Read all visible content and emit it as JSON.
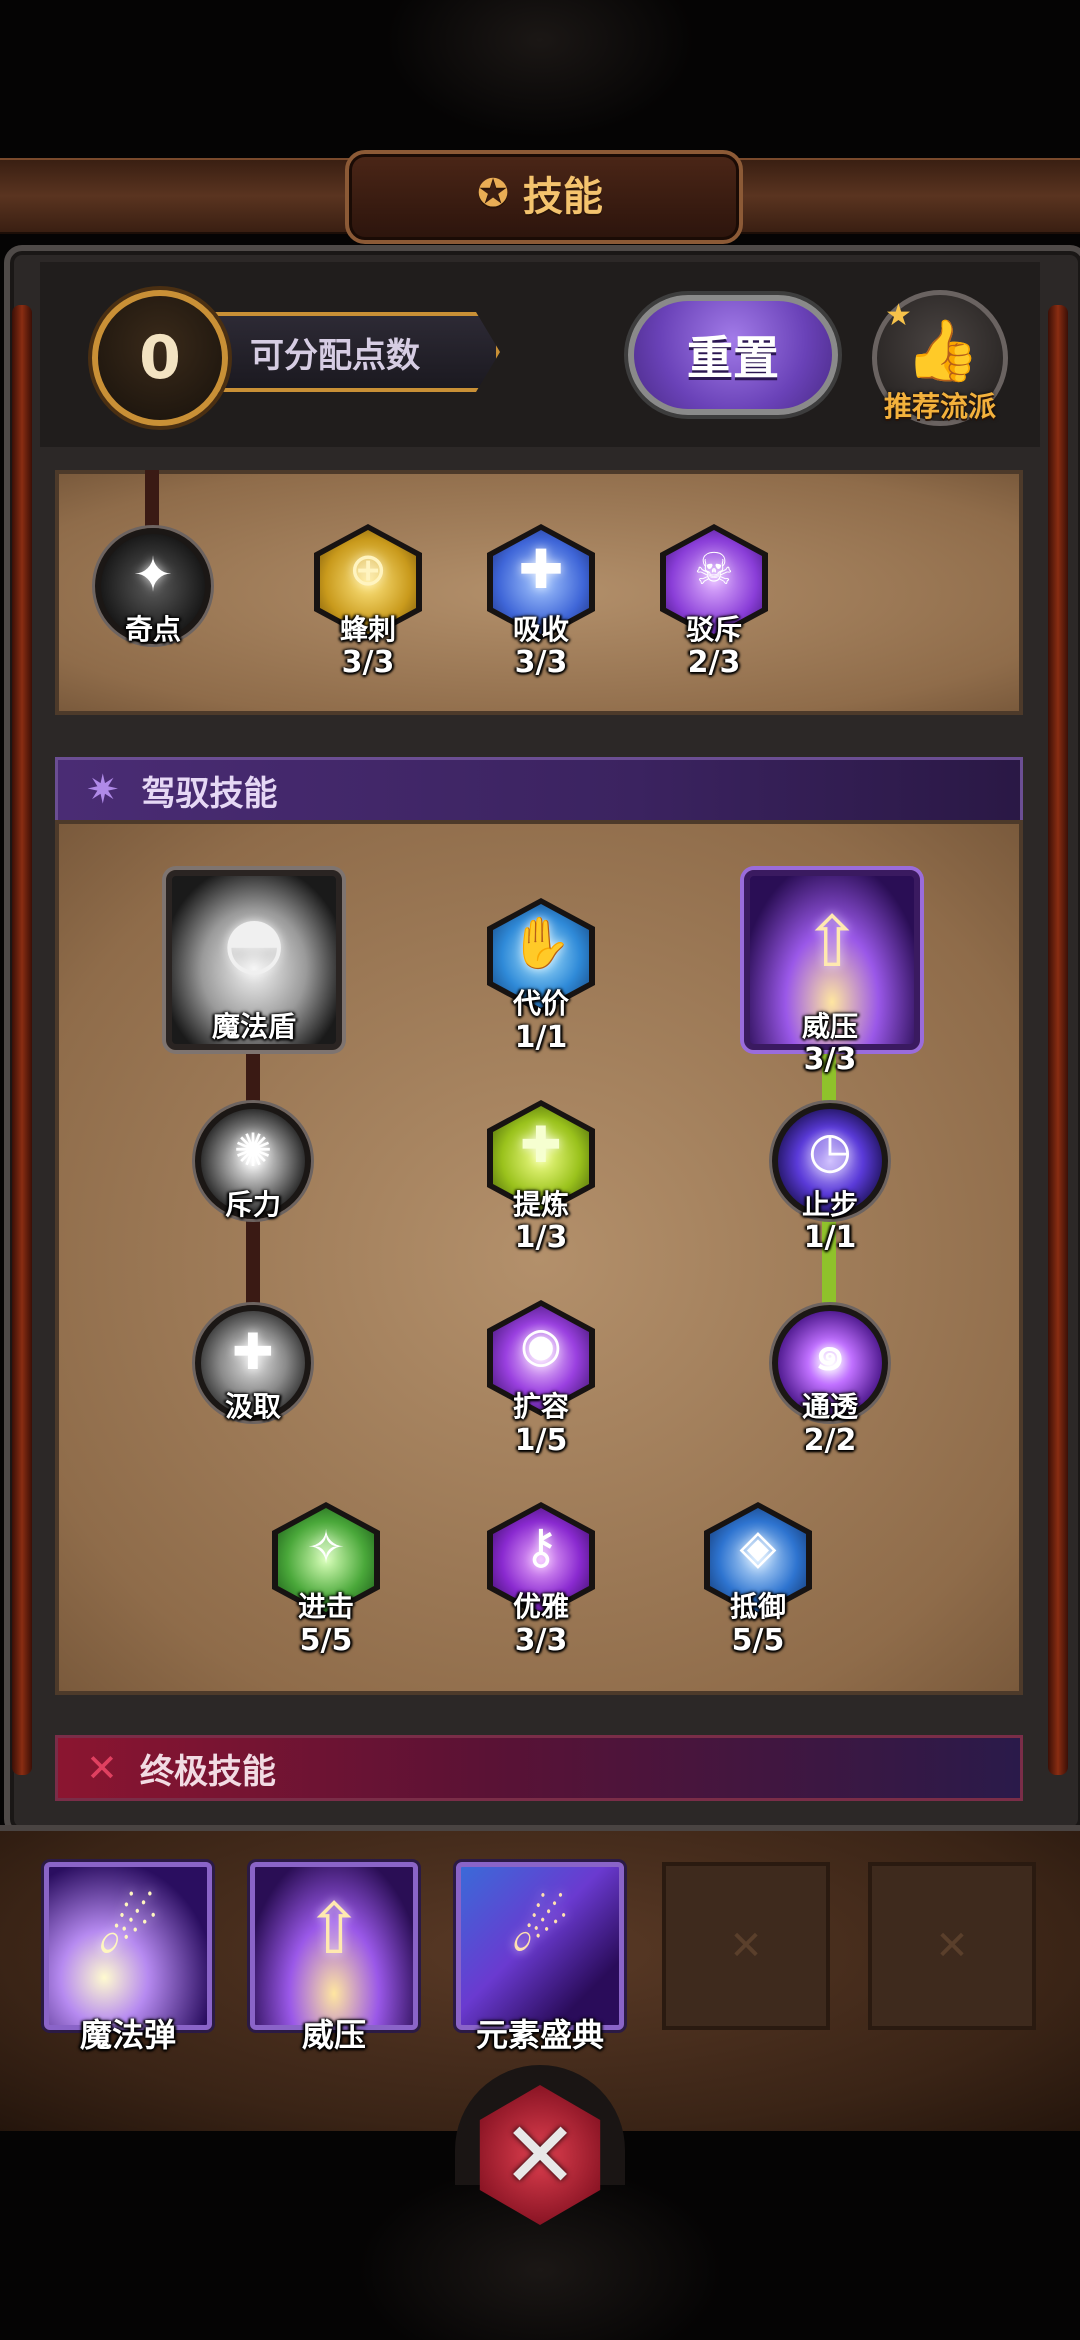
{
  "title": {
    "text": "技能"
  },
  "points": {
    "value": "0",
    "label": "可分配点数"
  },
  "buttons": {
    "reset": "重置",
    "recommend": "推荐流派"
  },
  "colors": {
    "accent_gold": "#f4c36e",
    "accent_purple": "#6a42b8",
    "active_link": "#8fc22b"
  },
  "top_row": [
    {
      "name": "奇点",
      "count": ""
    },
    {
      "name": "蜂刺",
      "count": "3/3"
    },
    {
      "name": "吸收",
      "count": "3/3"
    },
    {
      "name": "驳斥",
      "count": "2/3"
    }
  ],
  "section_control": {
    "title": "驾驭技能"
  },
  "control_skills": [
    {
      "name": "魔法盾",
      "count": ""
    },
    {
      "name": "代价",
      "count": "1/1"
    },
    {
      "name": "威压",
      "count": "3/3"
    },
    {
      "name": "斥力",
      "count": ""
    },
    {
      "name": "提炼",
      "count": "1/3"
    },
    {
      "name": "止步",
      "count": "1/1"
    },
    {
      "name": "汲取",
      "count": ""
    },
    {
      "name": "扩容",
      "count": "1/5"
    },
    {
      "name": "通透",
      "count": "2/2"
    },
    {
      "name": "进击",
      "count": "5/5"
    },
    {
      "name": "优雅",
      "count": "3/3"
    },
    {
      "name": "抵御",
      "count": "5/5"
    }
  ],
  "section_ultimate": {
    "title": "终极技能"
  },
  "ultimate_slots": [
    {
      "name": "魔法弹"
    },
    {
      "name": "威压"
    },
    {
      "name": "元素盛典"
    }
  ]
}
